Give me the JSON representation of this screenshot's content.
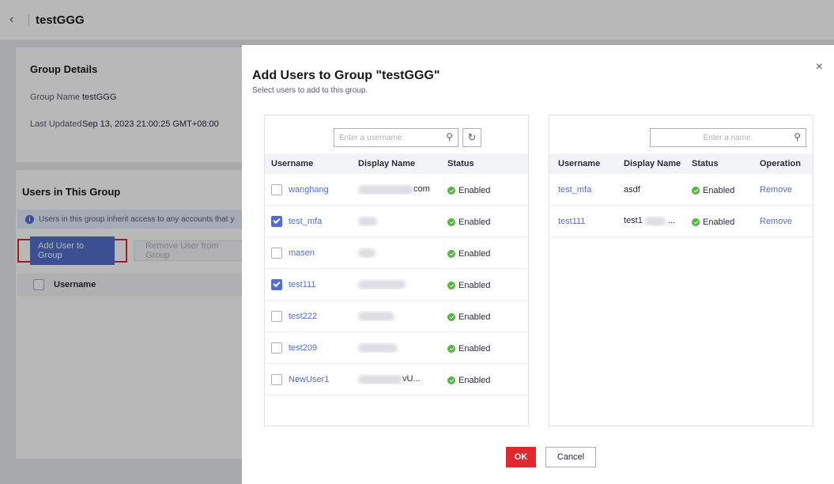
{
  "header": {
    "title": "testGGG"
  },
  "group_details": {
    "title": "Group Details",
    "group_name_label": "Group Name",
    "group_name_value": "testGGG",
    "last_updated_label": "Last Updated",
    "last_updated_value": "Sep 13, 2023 21:00:25 GMT+08:00"
  },
  "users_in_group": {
    "title": "Users in This Group",
    "info": "Users in this group inherit access to any accounts that y",
    "add_button": "Add User to Group",
    "remove_button": "Remove User from Group",
    "column_username": "Username"
  },
  "dialog": {
    "title": "Add Users to Group \"testGGG\"",
    "subtitle": "Select users to add to this group.",
    "left": {
      "search_placeholder": "Enter a username.",
      "columns": {
        "username": "Username",
        "display_name": "Display Name",
        "status": "Status"
      },
      "rows": [
        {
          "username": "wanghang",
          "display_tail": "com",
          "status": "Enabled",
          "checked": false
        },
        {
          "username": "test_mfa",
          "display_tail": "",
          "status": "Enabled",
          "checked": true
        },
        {
          "username": "masen",
          "display_tail": "",
          "status": "Enabled",
          "checked": false
        },
        {
          "username": "test111",
          "display_tail": "",
          "status": "Enabled",
          "checked": true
        },
        {
          "username": "test222",
          "display_tail": "",
          "status": "Enabled",
          "checked": false
        },
        {
          "username": "test209",
          "display_tail": "",
          "status": "Enabled",
          "checked": false
        },
        {
          "username": "NewUser1",
          "display_tail": "vU...",
          "status": "Enabled",
          "checked": false
        }
      ]
    },
    "right": {
      "search_placeholder": "Enter a name.",
      "columns": {
        "username": "Username",
        "display_name": "Display Name",
        "status": "Status",
        "operation": "Operation"
      },
      "rows": [
        {
          "username": "test_mfa",
          "display_name": "asdf",
          "status": "Enabled",
          "operation": "Remove"
        },
        {
          "username": "test111",
          "display_name": "test1",
          "display_tail": "...",
          "status": "Enabled",
          "operation": "Remove"
        }
      ]
    },
    "ok_button": "OK",
    "cancel_button": "Cancel"
  },
  "colors": {
    "primary": "#526ecc",
    "danger": "#e0282f",
    "success": "#50b83c"
  }
}
